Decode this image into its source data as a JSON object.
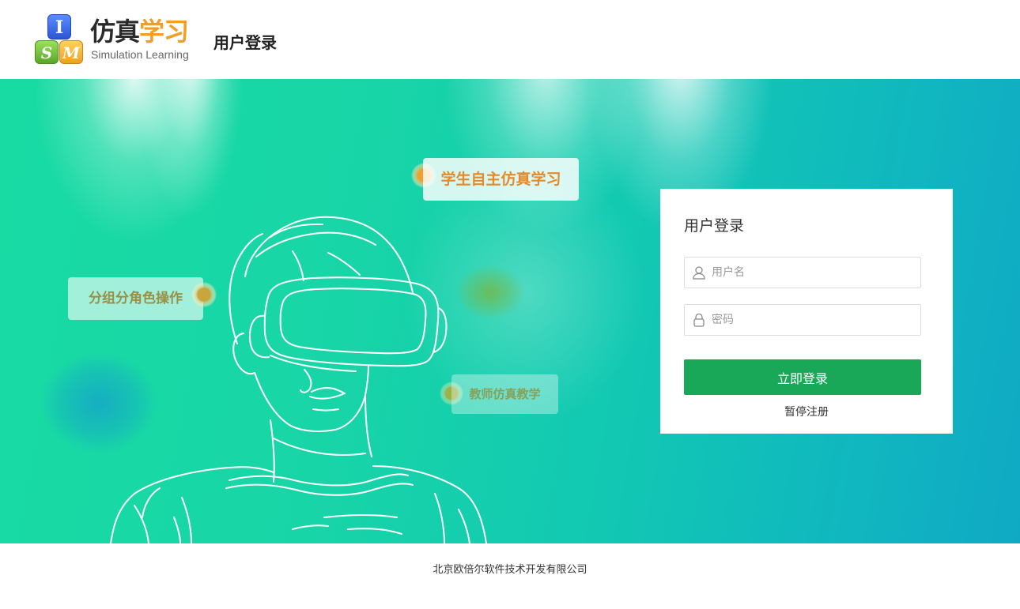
{
  "header": {
    "logo_letters": [
      "I",
      "S",
      "M"
    ],
    "brand_cn_dark": "仿真",
    "brand_cn_accent": "学习",
    "brand_en": "Simulation Learning",
    "page_title": "用户登录"
  },
  "banner": {
    "tags": [
      "学生自主仿真学习",
      "分组分角色操作",
      "教师仿真教学"
    ]
  },
  "login": {
    "title": "用户登录",
    "username_placeholder": "用户名",
    "password_placeholder": "密码",
    "submit_label": "立即登录",
    "register_label": "暂停注册"
  },
  "footer": {
    "copyright": "北京欧倍尔软件技术开发有限公司"
  },
  "colors": {
    "accent_green": "#18a857",
    "brand_orange": "#f0a020",
    "banner_start": "#18dba3",
    "banner_end": "#0fa9c4"
  },
  "icons": [
    "user-icon",
    "lock-icon"
  ]
}
